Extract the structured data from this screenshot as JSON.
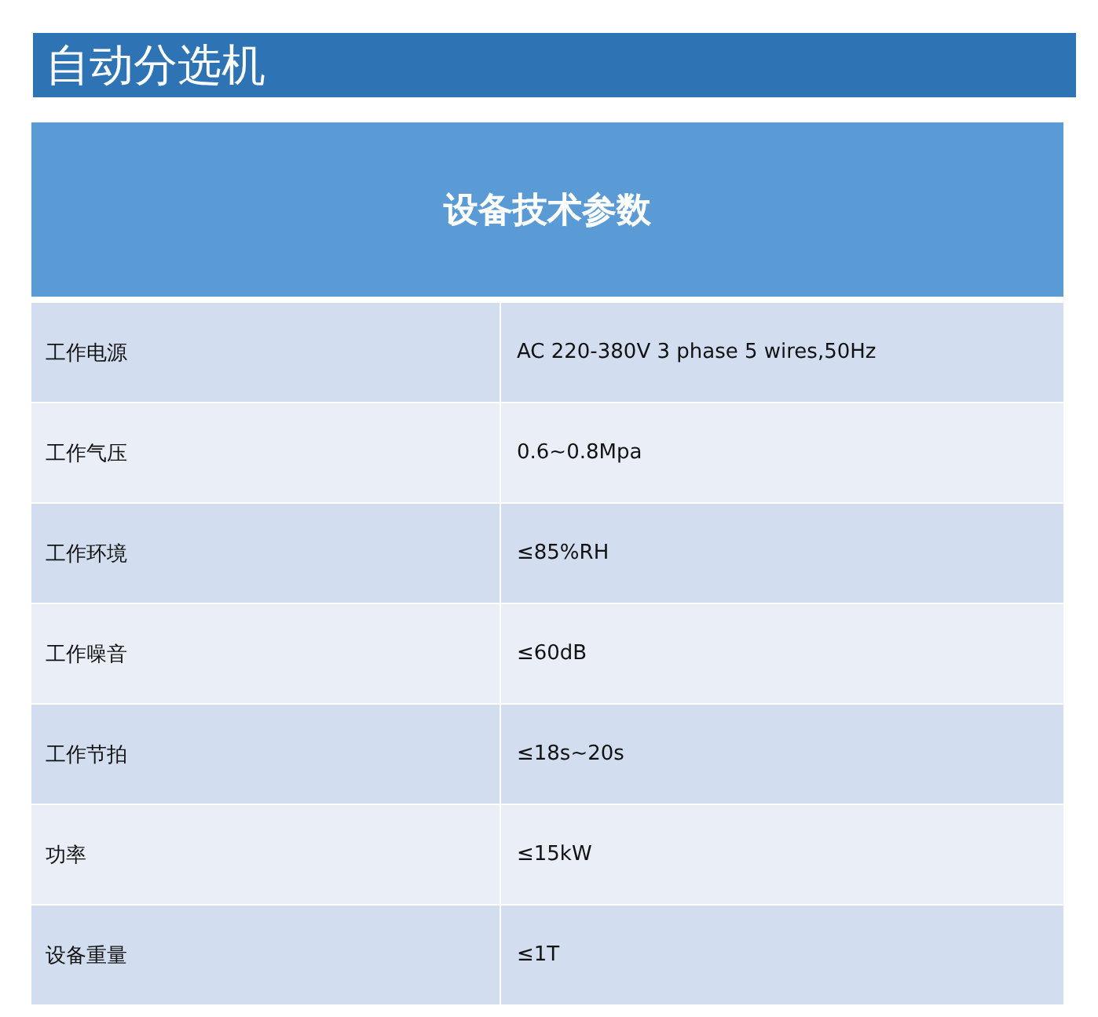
{
  "title": "自动分选机",
  "table": {
    "heading": "设备技术参数",
    "rows": [
      {
        "label": "工作电源",
        "value": "AC 220-380V 3 phase 5 wires,50Hz"
      },
      {
        "label": "工作气压",
        "value": "0.6~0.8Mpa"
      },
      {
        "label": "工作环境",
        "value": "≤85%RH"
      },
      {
        "label": "工作噪音",
        "value": "≤60dB"
      },
      {
        "label": "工作节拍",
        "value": "≤18s~20s"
      },
      {
        "label": "功率",
        "value": "≤15kW"
      },
      {
        "label": "设备重量",
        "value": "≤1T"
      }
    ]
  }
}
